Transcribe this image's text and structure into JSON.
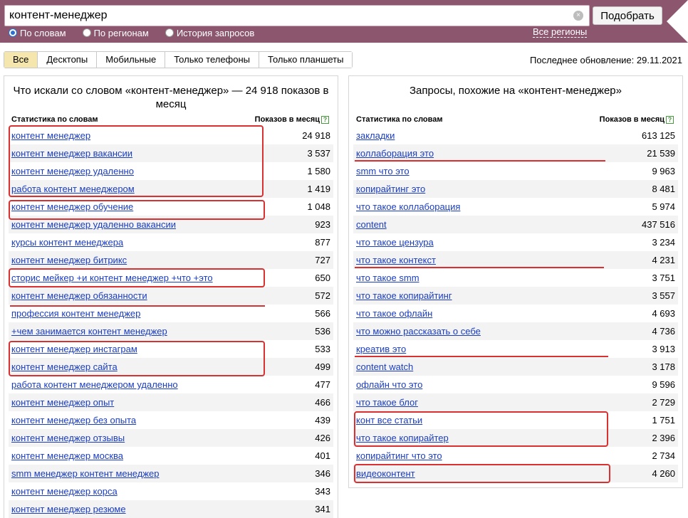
{
  "search": {
    "value": "контент-менеджер",
    "clear_label": "×",
    "submit_label": "Подобрать"
  },
  "modes": [
    {
      "label": "По словам",
      "checked": true
    },
    {
      "label": "По регионам",
      "checked": false
    },
    {
      "label": "История запросов",
      "checked": false
    }
  ],
  "regions_label": "Все регионы",
  "tabs": [
    "Все",
    "Десктопы",
    "Мобильные",
    "Только телефоны",
    "Только планшеты"
  ],
  "active_tab": "Все",
  "last_update": "Последнее обновление: 29.11.2021",
  "left_panel": {
    "title": "Что искали со словом «контент-менеджер» — 24 918 показов в месяц",
    "col_name": "Статистика по словам",
    "col_count": "Показов в месяц",
    "help_label": "?",
    "rows": [
      {
        "query": "контент менеджер",
        "count": "24 918"
      },
      {
        "query": "контент менеджер вакансии",
        "count": "3 537"
      },
      {
        "query": "контент менеджер удаленно",
        "count": "1 580"
      },
      {
        "query": "работа контент менеджером",
        "count": "1 419"
      },
      {
        "query": "контент менеджер обучение",
        "count": "1 048"
      },
      {
        "query": "контент менеджер удаленно вакансии",
        "count": "923"
      },
      {
        "query": "курсы контент менеджера",
        "count": "877"
      },
      {
        "query": "контент менеджер битрикс",
        "count": "727"
      },
      {
        "query": "сторис мейкер +и контент менеджер +что +это",
        "count": "650"
      },
      {
        "query": "контент менеджер обязанности",
        "count": "572"
      },
      {
        "query": "профессия контент менеджер",
        "count": "566"
      },
      {
        "query": "+чем занимается контент менеджер",
        "count": "536"
      },
      {
        "query": "контент менеджер инстаграм",
        "count": "533"
      },
      {
        "query": "контент менеджер сайта",
        "count": "499"
      },
      {
        "query": "работа контент менеджером удаленно",
        "count": "477"
      },
      {
        "query": "контент менеджер опыт",
        "count": "466"
      },
      {
        "query": "контент менеджер без опыта",
        "count": "439"
      },
      {
        "query": "контент менеджер отзывы",
        "count": "426"
      },
      {
        "query": "контент менеджер москва",
        "count": "401"
      },
      {
        "query": "smm менеджер контент менеджер",
        "count": "346"
      },
      {
        "query": "контент менеджер корса",
        "count": "343"
      },
      {
        "query": "контент менеджер резюме",
        "count": "341"
      }
    ]
  },
  "right_panel": {
    "title": "Запросы, похожие на «контент-менеджер»",
    "col_name": "Статистика по словам",
    "col_count": "Показов в месяц",
    "help_label": "?",
    "rows": [
      {
        "query": "закладки",
        "count": "613 125"
      },
      {
        "query": "коллаборация это",
        "count": "21 539"
      },
      {
        "query": "smm что это",
        "count": "9 963"
      },
      {
        "query": "копирайтинг это",
        "count": "8 481"
      },
      {
        "query": "что такое коллаборация",
        "count": "5 974"
      },
      {
        "query": "content",
        "count": "437 516"
      },
      {
        "query": "что такое цензура",
        "count": "3 234"
      },
      {
        "query": "что такое контекст",
        "count": "4 231"
      },
      {
        "query": "что такое smm",
        "count": "3 751"
      },
      {
        "query": "что такое копирайтинг",
        "count": "3 557"
      },
      {
        "query": "что такое офлайн",
        "count": "4 693"
      },
      {
        "query": "что можно рассказать о себе",
        "count": "4 736"
      },
      {
        "query": "креатив это",
        "count": "3 913"
      },
      {
        "query": "content watch",
        "count": "3 178"
      },
      {
        "query": "офлайн что это",
        "count": "9 596"
      },
      {
        "query": "что такое блог",
        "count": "2 729"
      },
      {
        "query": "конт все статьи",
        "count": "1 751"
      },
      {
        "query": "что такое копирайтер",
        "count": "2 396"
      },
      {
        "query": "копирайтинг что это",
        "count": "2 734"
      },
      {
        "query": "видеоконтент",
        "count": "4 260"
      }
    ]
  },
  "annotation_color": "#d93131"
}
